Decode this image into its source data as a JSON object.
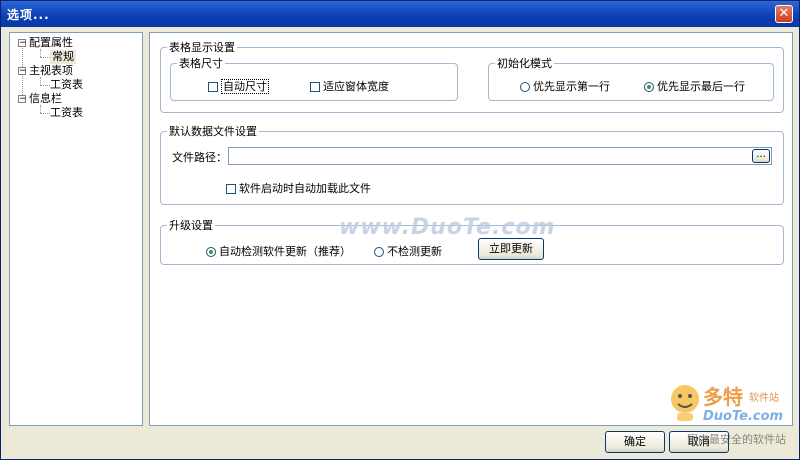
{
  "window": {
    "title": "选项..."
  },
  "tree": {
    "nodes": [
      {
        "label": "配置属性",
        "expander": "⊟"
      },
      {
        "label": "常规"
      },
      {
        "label": "主视表项",
        "expander": "⊟"
      },
      {
        "label": "工资表"
      },
      {
        "label": "信息栏",
        "expander": "⊟"
      },
      {
        "label": "工资表"
      }
    ]
  },
  "table_display": {
    "legend": "表格显示设置",
    "size": {
      "legend": "表格尺寸",
      "auto_size": "自动尺寸",
      "fit_width": "适应窗体宽度"
    },
    "init_mode": {
      "legend": "初始化模式",
      "first_row": "优先显示第一行",
      "last_row": "优先显示最后一行"
    }
  },
  "data_file": {
    "legend": "默认数据文件设置",
    "path_label": "文件路径：",
    "path_value": "",
    "browse": "...",
    "autoload": "软件启动时自动加载此文件"
  },
  "upgrade": {
    "legend": "升级设置",
    "auto_check": "自动检测软件更新（推荐）",
    "no_check": "不检测更新",
    "update_now": "立即更新"
  },
  "buttons": {
    "ok": "确定",
    "cancel": "取消"
  },
  "watermark": {
    "text": "www.DuoTe.com"
  },
  "logo": {
    "brand": "多特",
    "suffix": "软件站",
    "domain": "DuoTe.com",
    "slogan": "国内最安全的软件站"
  },
  "colors": {
    "titlebar": "#0a3fb4",
    "frame": "#ece9d8",
    "radio_dot": "#3a9a3a"
  }
}
